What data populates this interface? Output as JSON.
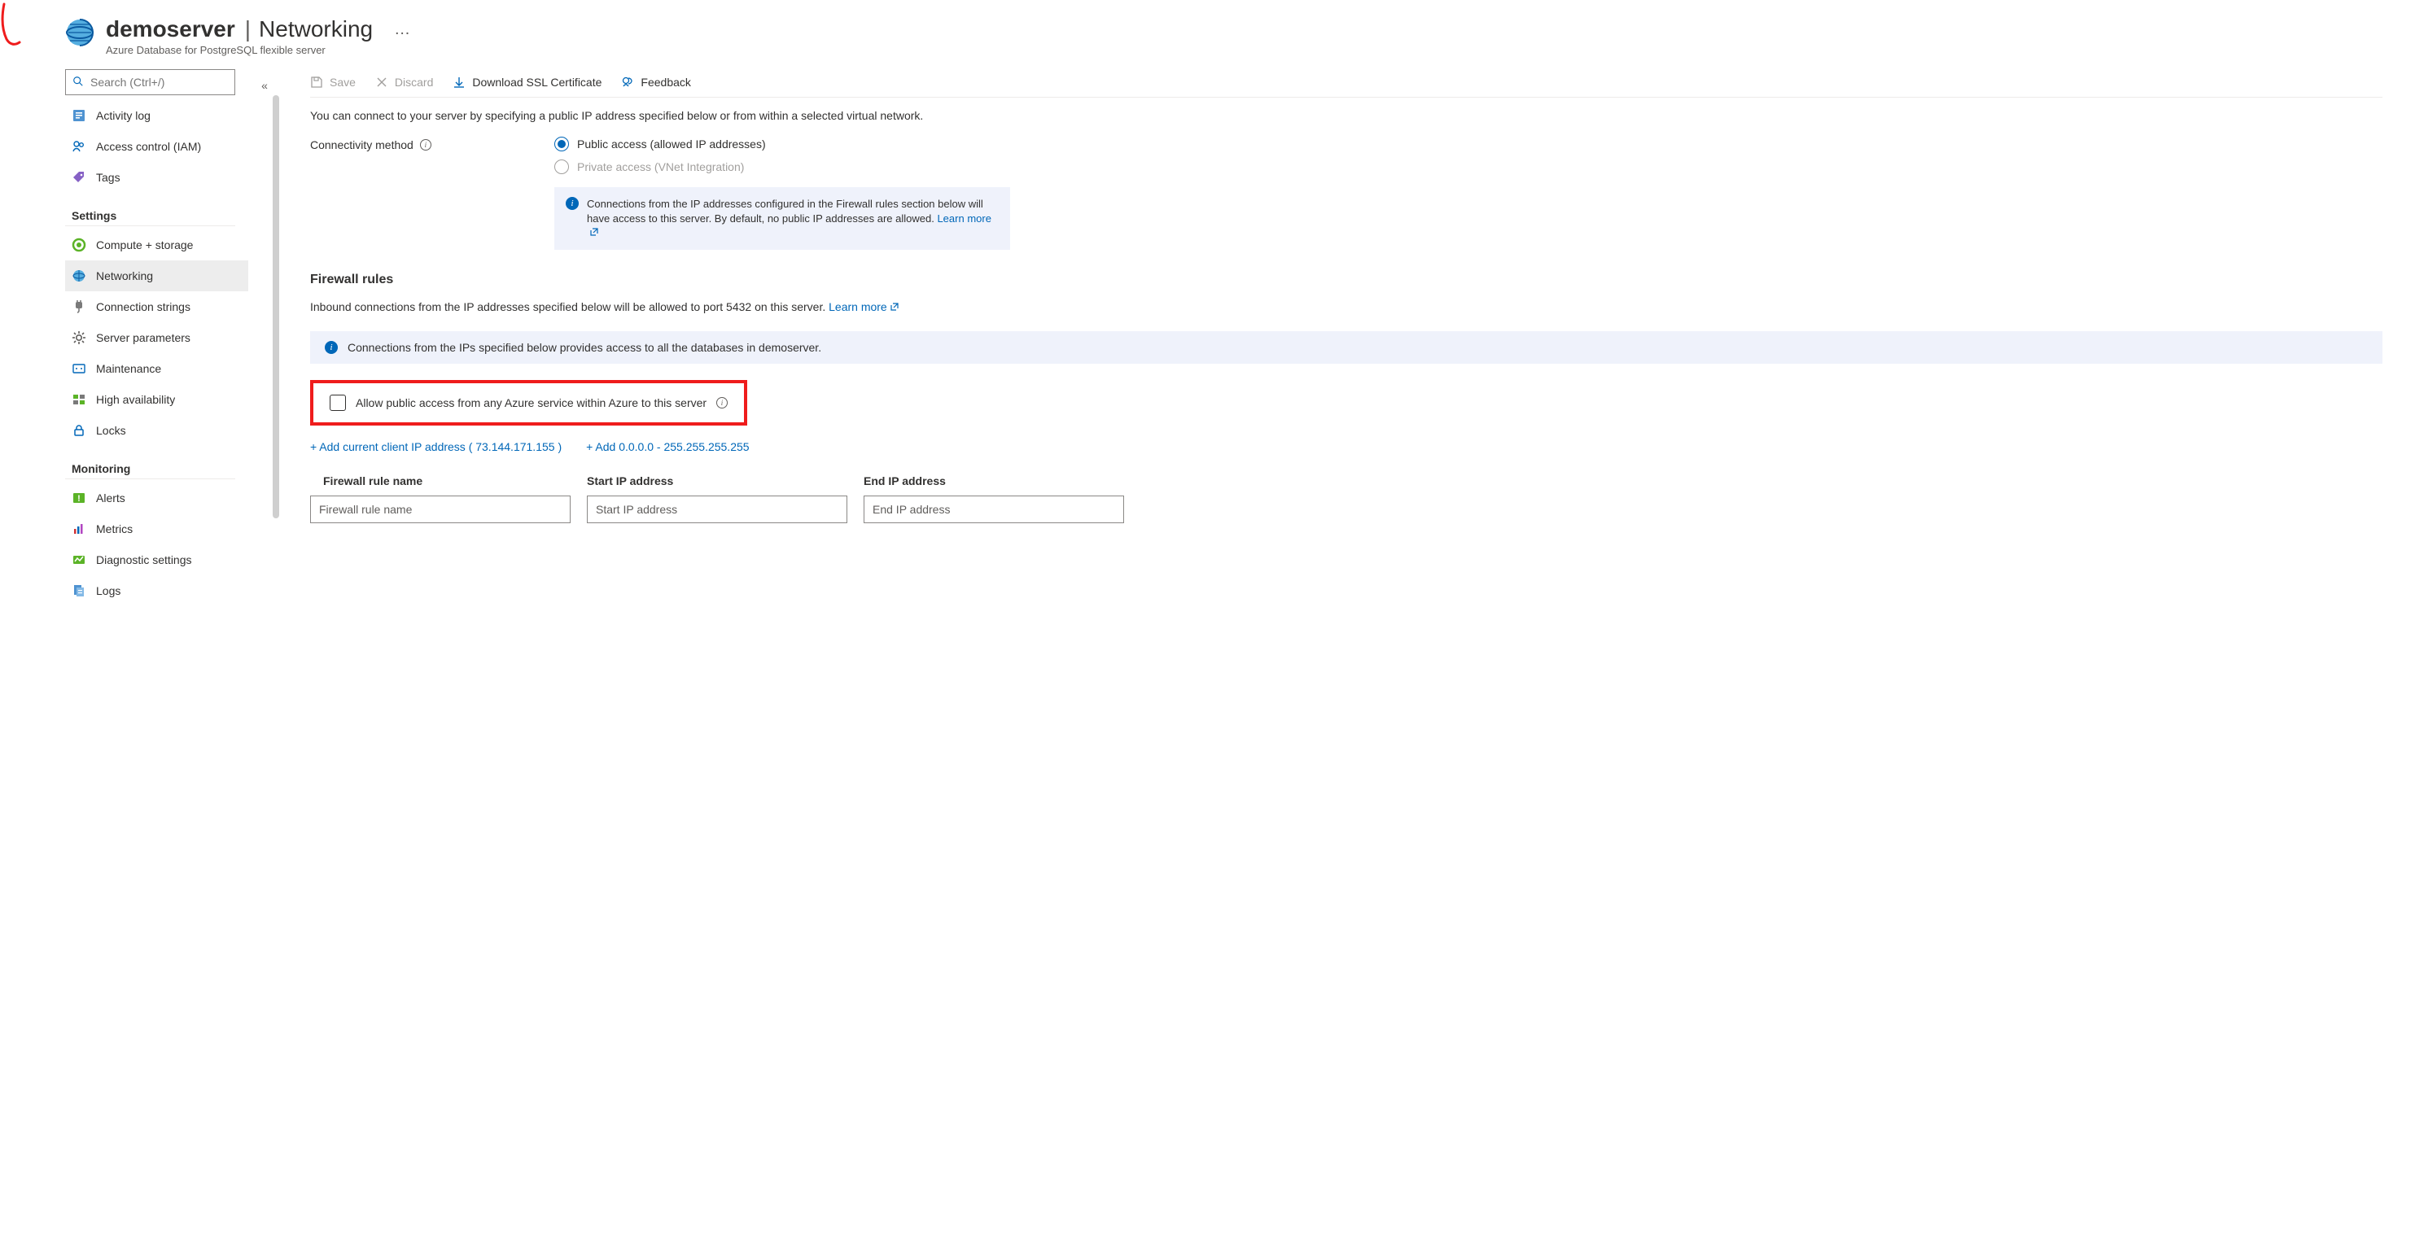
{
  "header": {
    "resource_name": "demoserver",
    "separator": "|",
    "section": "Networking",
    "ellipsis": "…",
    "subtitle": "Azure Database for PostgreSQL flexible server"
  },
  "sidebar": {
    "search_placeholder": "Search (Ctrl+/)",
    "collapse_glyph": "«",
    "top_items": [
      {
        "id": "activity-log",
        "label": "Activity log",
        "icon": "log"
      },
      {
        "id": "access-control",
        "label": "Access control (IAM)",
        "icon": "people"
      },
      {
        "id": "tags",
        "label": "Tags",
        "icon": "tag"
      }
    ],
    "groups": [
      {
        "name": "Settings",
        "items": [
          {
            "id": "compute-storage",
            "label": "Compute + storage",
            "icon": "compute"
          },
          {
            "id": "networking",
            "label": "Networking",
            "icon": "globe",
            "selected": true
          },
          {
            "id": "connection-strings",
            "label": "Connection strings",
            "icon": "plug"
          },
          {
            "id": "server-parameters",
            "label": "Server parameters",
            "icon": "gear"
          },
          {
            "id": "maintenance",
            "label": "Maintenance",
            "icon": "maintenance"
          },
          {
            "id": "high-availability",
            "label": "High availability",
            "icon": "ha"
          },
          {
            "id": "locks",
            "label": "Locks",
            "icon": "lock"
          }
        ]
      },
      {
        "name": "Monitoring",
        "items": [
          {
            "id": "alerts",
            "label": "Alerts",
            "icon": "alert"
          },
          {
            "id": "metrics",
            "label": "Metrics",
            "icon": "metrics"
          },
          {
            "id": "diagnostic-settings",
            "label": "Diagnostic settings",
            "icon": "diag"
          },
          {
            "id": "logs",
            "label": "Logs",
            "icon": "logs"
          }
        ]
      }
    ]
  },
  "toolbar": {
    "save": "Save",
    "discard": "Discard",
    "download_ssl": "Download SSL Certificate",
    "feedback": "Feedback"
  },
  "main": {
    "intro": "You can connect to your server by specifying a public IP address specified below or from within a selected virtual network.",
    "connectivity": {
      "label": "Connectivity method",
      "options": {
        "public": "Public access (allowed IP addresses)",
        "private": "Private access (VNet Integration)"
      }
    },
    "conn_info_banner": {
      "text": "Connections from the IP addresses configured in the Firewall rules section below will have access to this server. By default, no public IP addresses are allowed. ",
      "link": "Learn more"
    },
    "firewall": {
      "heading": "Firewall rules",
      "desc_prefix": "Inbound connections from the IP addresses specified below will be allowed to port 5432 on this server. ",
      "desc_link": "Learn more",
      "db_banner": "Connections from the IPs specified below provides access to all the databases in demoserver.",
      "allow_azure": "Allow public access from any Azure service within Azure to this server",
      "add_client_ip": "+ Add current client IP address ( 73.144.171.155 )",
      "add_all": "+ Add 0.0.0.0 - 255.255.255.255",
      "columns": {
        "name": "Firewall rule name",
        "start": "Start IP address",
        "end": "End IP address"
      },
      "placeholders": {
        "name": "Firewall rule name",
        "start": "Start IP address",
        "end": "End IP address"
      }
    }
  }
}
